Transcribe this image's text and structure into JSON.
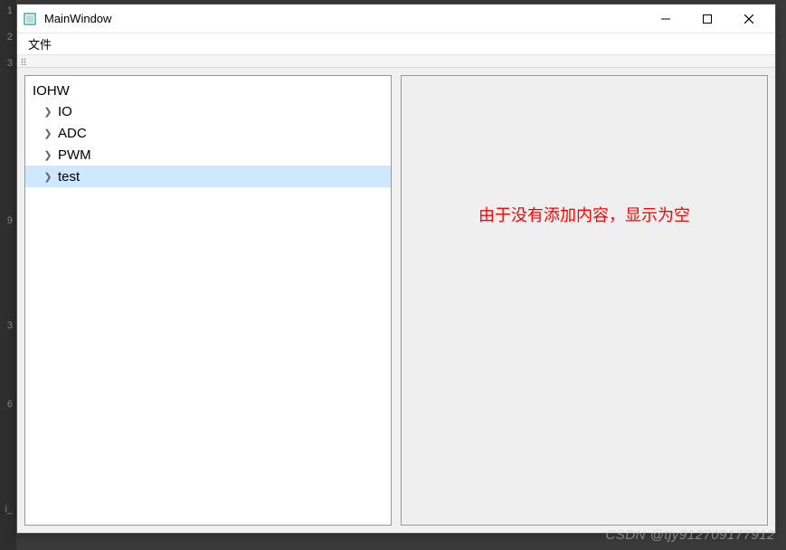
{
  "window": {
    "title": "MainWindow"
  },
  "menubar": {
    "file": "文件"
  },
  "tree": {
    "root": "IOHW",
    "items": [
      {
        "label": "IO",
        "selected": false
      },
      {
        "label": "ADC",
        "selected": false
      },
      {
        "label": "PWM",
        "selected": false
      },
      {
        "label": "test",
        "selected": true
      }
    ]
  },
  "right_panel": {
    "empty_message": "由于没有添加内容，显示为空"
  },
  "watermark": "CSDN @tjy912709177912"
}
